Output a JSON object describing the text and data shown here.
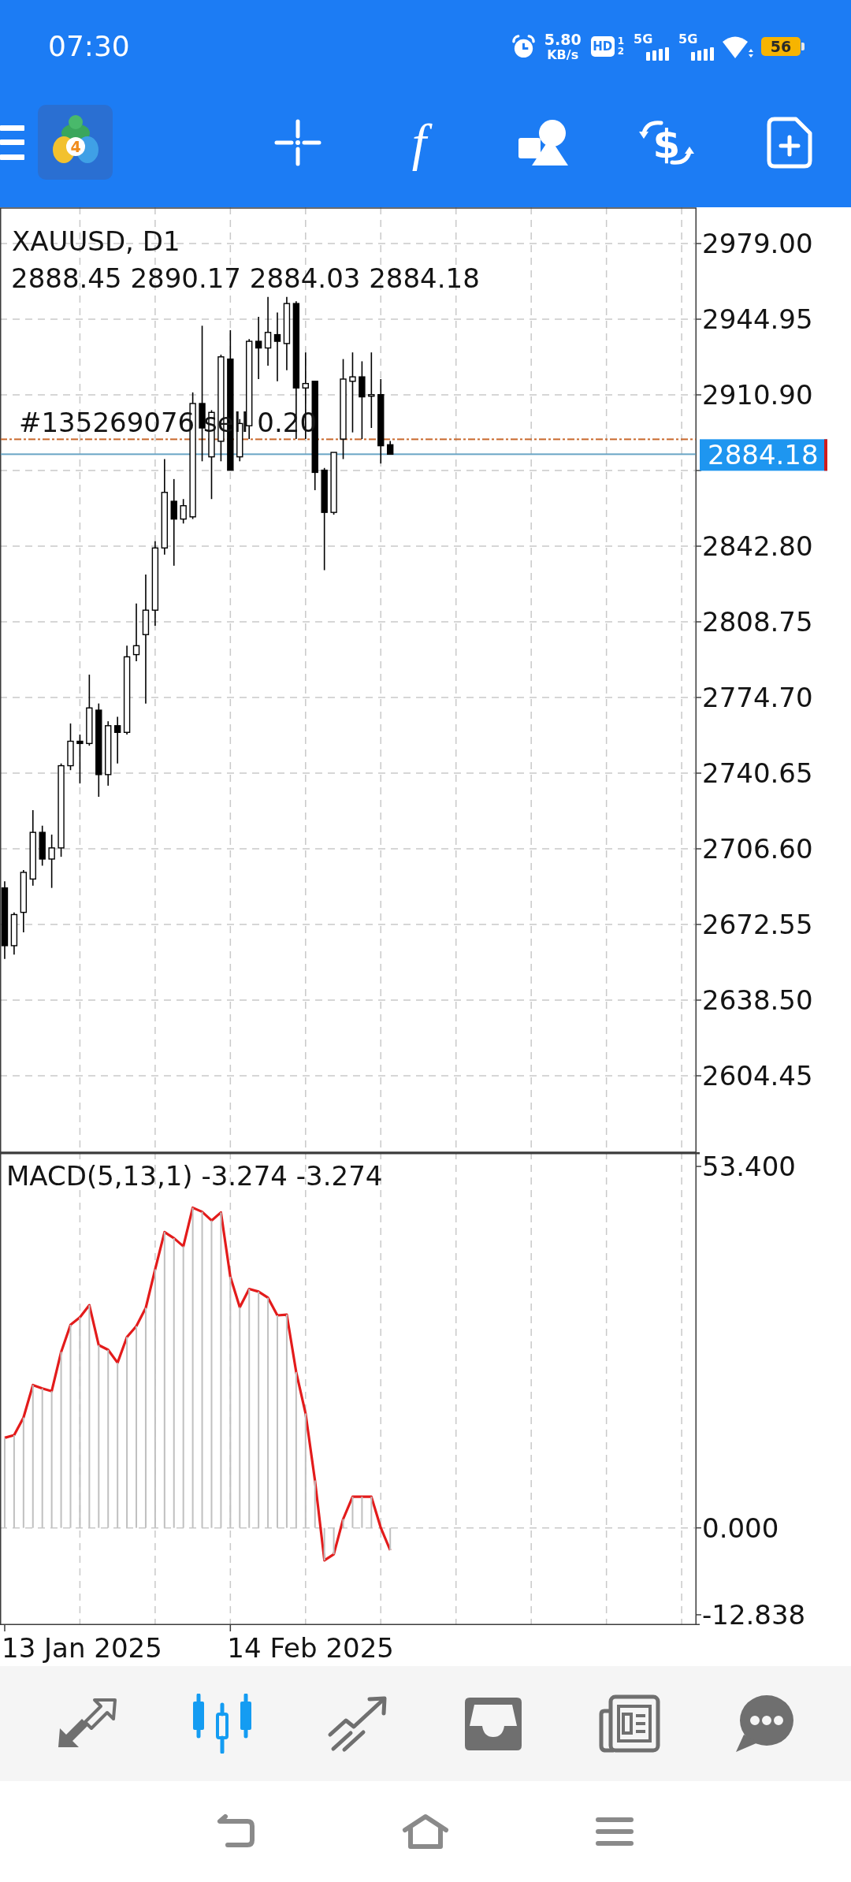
{
  "status_bar": {
    "time": "07:30",
    "net_speed": "5.80",
    "net_speed_unit": "KB/s",
    "hd_badge": "HD",
    "sim_slots": [
      "1",
      "2"
    ],
    "networks": [
      "5G",
      "5G"
    ],
    "battery": "56"
  },
  "toolbar": {
    "logo_badge": "4",
    "tools": [
      {
        "kind": "crosshair"
      },
      {
        "kind": "function",
        "glyph": "f"
      },
      {
        "kind": "objects"
      },
      {
        "kind": "trade",
        "glyph": "$"
      },
      {
        "kind": "new-order"
      }
    ]
  },
  "chart": {
    "ohlc_values": "2888.45 2890.17 2884.03 2884.18",
    "current_price": "2884.18",
    "chart_data": {
      "type": "candlestick",
      "title": "XAUUSD, D1",
      "grid": true,
      "categories": [
        null,
        null,
        null,
        null,
        null,
        null,
        null,
        null,
        null,
        null,
        null,
        null,
        null,
        null,
        null,
        null,
        null,
        null,
        null,
        null,
        null,
        null,
        null,
        null,
        null,
        null,
        null,
        null,
        null,
        null,
        null,
        null,
        null,
        null,
        null,
        null,
        null,
        null,
        null,
        null,
        null,
        null,
        null,
        null,
        null,
        null,
        null,
        null,
        null,
        null,
        null,
        null,
        null,
        null,
        null,
        null,
        null,
        null,
        null,
        null,
        null,
        null,
        null,
        null,
        null,
        null,
        null,
        null,
        null,
        null,
        null,
        null,
        null,
        null
      ],
      "ylim": [
        2570.05,
        2995.32
      ],
      "yticks": [
        {
          "value": 2979,
          "label": "2979.00"
        },
        {
          "value": 2944.95,
          "label": "2944.95"
        },
        {
          "value": 2910.9,
          "label": "2910.90"
        },
        {
          "value": 2842.8,
          "label": "2842.80"
        },
        {
          "value": 2808.75,
          "label": "2808.75"
        },
        {
          "value": 2774.7,
          "label": "2774.70"
        },
        {
          "value": 2740.65,
          "label": "2740.65"
        },
        {
          "value": 2706.6,
          "label": "2706.60"
        },
        {
          "value": 2672.55,
          "label": "2672.55"
        },
        {
          "value": 2638.5,
          "label": "2638.50"
        },
        {
          "value": 2604.45,
          "label": "2604.45"
        }
      ],
      "ohlc": [
        [
          2689,
          2692,
          2657,
          2663
        ],
        [
          2663,
          2678,
          2659,
          2677
        ],
        [
          2678,
          2697,
          2669,
          2696
        ],
        [
          2693,
          2724,
          2690,
          2714
        ],
        [
          2714,
          2717,
          2699,
          2702
        ],
        [
          2702,
          2713,
          2689,
          2707
        ],
        [
          2707,
          2745,
          2703,
          2744
        ],
        [
          2744,
          2763,
          2742,
          2755
        ],
        [
          2755,
          2758,
          2736,
          2754
        ],
        [
          2754,
          2785,
          2753,
          2770
        ],
        [
          2769,
          2772,
          2730,
          2740
        ],
        [
          2740,
          2764,
          2735,
          2762
        ],
        [
          2762,
          2766,
          2745,
          2759
        ],
        [
          2759,
          2798,
          2758,
          2793
        ],
        [
          2794,
          2817,
          2791,
          2798
        ],
        [
          2803,
          2830,
          2772,
          2814
        ],
        [
          2814,
          2845,
          2807,
          2842
        ],
        [
          2842,
          2882,
          2839,
          2867
        ],
        [
          2863,
          2873,
          2834,
          2855
        ],
        [
          2855,
          2864,
          2853,
          2861
        ],
        [
          2856,
          2912,
          2855,
          2907
        ],
        [
          2907,
          2942,
          2881,
          2896
        ],
        [
          2883,
          2904,
          2864,
          2903
        ],
        [
          2890,
          2929,
          2881,
          2928
        ],
        [
          2927,
          2940,
          2877,
          2877
        ],
        [
          2883,
          2900,
          2881,
          2898
        ],
        [
          2897,
          2936,
          2891,
          2935
        ],
        [
          2935,
          2946,
          2918,
          2932
        ],
        [
          2932,
          2955,
          2924,
          2939
        ],
        [
          2938,
          2948,
          2917,
          2935
        ],
        [
          2934,
          2955,
          2922,
          2952
        ],
        [
          2952,
          2953,
          2891,
          2914
        ],
        [
          2914,
          2930,
          2891,
          2916
        ],
        [
          2917,
          2917,
          2868,
          2876
        ],
        [
          2877,
          2878,
          2832,
          2858
        ],
        [
          2858,
          2885,
          2857,
          2885
        ],
        [
          2891,
          2927,
          2882,
          2918
        ],
        [
          2917,
          2930,
          2894,
          2919
        ],
        [
          2919,
          2926,
          2891,
          2910
        ],
        [
          2911,
          2930,
          2896,
          2911
        ],
        [
          2911,
          2918,
          2880,
          2888
        ],
        [
          2888.45,
          2890.17,
          2884.03,
          2884.18
        ],
        null,
        null,
        null,
        null,
        null,
        null,
        null,
        null,
        null,
        null,
        null,
        null,
        null,
        null,
        null,
        null,
        null,
        null,
        null,
        null,
        null,
        null,
        null,
        null,
        null,
        null,
        null,
        null,
        null,
        null,
        null,
        null
      ],
      "ref_lines": [
        {
          "axis": "y",
          "value": 2884.18,
          "color": "#6aa5c6"
        },
        {
          "axis": "y",
          "value": 2890.9,
          "label": "#135269076 sell 0.20",
          "color": "#c8682c"
        }
      ]
    }
  },
  "macd": {
    "chart_data": {
      "type": "bar",
      "title": "MACD(5,13,1) -3.274 -3.274",
      "grid": true,
      "categories": [
        null,
        null,
        null,
        null,
        null,
        null,
        null,
        null,
        null,
        null,
        null,
        null,
        null,
        null,
        null,
        null,
        null,
        null,
        null,
        null,
        null,
        null,
        null,
        null,
        null,
        null,
        null,
        null,
        null,
        null,
        null,
        null,
        null,
        null,
        null,
        null,
        null,
        null,
        null,
        null,
        null,
        null,
        null,
        null,
        null,
        null,
        null,
        null,
        null,
        null,
        null,
        null,
        null,
        null,
        null,
        null,
        null,
        null,
        null,
        null,
        null,
        null,
        null,
        null,
        null,
        null,
        null,
        null,
        null,
        null,
        null,
        null,
        null,
        null
      ],
      "ylim": [
        -14.36,
        55.5
      ],
      "yticks": [
        {
          "value": 53.4,
          "label": "53.400"
        },
        {
          "value": 0,
          "label": "0.000"
        },
        {
          "value": -12.838,
          "label": "-12.838"
        }
      ],
      "series": [
        {
          "color": "#c0c0c0",
          "values": [
            13.3,
            13.7,
            16.3,
            21.1,
            20.6,
            20.2,
            26,
            30,
            31.1,
            32.9,
            27,
            26.3,
            24.4,
            28.2,
            29.8,
            32.5,
            38.2,
            43.7,
            42.8,
            41.6,
            47.3,
            46.7,
            45.4,
            46.6,
            37.1,
            32.6,
            35.3,
            34.9,
            34,
            31.4,
            31.5,
            23,
            16.9,
            7,
            -4.8,
            -3.9,
            1.3,
            4.6,
            4.6,
            4.6,
            0,
            -3.3,
            null,
            null,
            null,
            null,
            null,
            null,
            null,
            null,
            null,
            null,
            null,
            null,
            null,
            null,
            null,
            null,
            null,
            null,
            null,
            null,
            null,
            null,
            null,
            null,
            null,
            null,
            null,
            null,
            null,
            null,
            null,
            null
          ]
        },
        {
          "type": "line",
          "color": "#e31b1b",
          "values": [
            13.3,
            13.7,
            16.3,
            21.1,
            20.6,
            20.2,
            26,
            30,
            31.1,
            32.9,
            27,
            26.3,
            24.4,
            28.2,
            29.8,
            32.5,
            38.2,
            43.7,
            42.8,
            41.6,
            47.3,
            46.7,
            45.4,
            46.6,
            37.1,
            32.6,
            35.3,
            34.9,
            34,
            31.4,
            31.5,
            23,
            16.9,
            7,
            -4.8,
            -3.9,
            1.3,
            4.6,
            4.6,
            4.6,
            0,
            -3.3,
            null,
            null,
            null,
            null,
            null,
            null,
            null,
            null,
            null,
            null,
            null,
            null,
            null,
            null,
            null,
            null,
            null,
            null,
            null,
            null,
            null,
            null,
            null,
            null,
            null,
            null,
            null,
            null,
            null,
            null,
            null,
            null
          ]
        }
      ]
    }
  },
  "time_axis": {
    "labels": [
      "13 Jan 2025",
      "14 Feb 2025"
    ]
  },
  "bottom_nav": [
    {
      "kind": "quotes",
      "selected": false
    },
    {
      "kind": "chart",
      "selected": true
    },
    {
      "kind": "trade",
      "selected": false
    },
    {
      "kind": "history",
      "selected": false
    },
    {
      "kind": "news",
      "selected": false
    },
    {
      "kind": "chat",
      "selected": false
    }
  ]
}
